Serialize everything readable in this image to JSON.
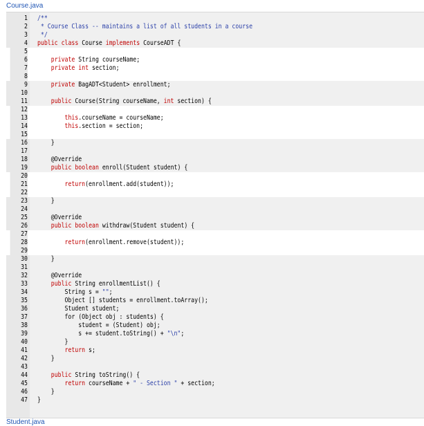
{
  "files": {
    "current": "Course.java",
    "next": "Student.java"
  },
  "colors": {
    "keyword": "#c00000",
    "comment": "#2a3fa8",
    "link": "#1f55b4"
  },
  "lines": [
    {
      "n": "1",
      "t": "/**",
      "h": false
    },
    {
      "n": "2",
      "t": " * Course Class -- maintains a list of all students in a course",
      "h": false
    },
    {
      "n": "3",
      "t": " */",
      "h": false
    },
    {
      "n": "4",
      "t": "public class Course implements CourseADT {",
      "h": false
    },
    {
      "n": "5",
      "t": "",
      "h": true
    },
    {
      "n": "6",
      "t": "    private String courseName;",
      "h": true
    },
    {
      "n": "7",
      "t": "    private int section;",
      "h": true
    },
    {
      "n": "8",
      "t": "",
      "h": true
    },
    {
      "n": "9",
      "t": "    private BagADT<Student> enrollment;",
      "h": false
    },
    {
      "n": "10",
      "t": "",
      "h": false
    },
    {
      "n": "11",
      "t": "    public Course(String courseName, int section) {",
      "h": false
    },
    {
      "n": "12",
      "t": "",
      "h": true
    },
    {
      "n": "13",
      "t": "        this.courseName = courseName;",
      "h": true
    },
    {
      "n": "14",
      "t": "        this.section = section;",
      "h": true
    },
    {
      "n": "15",
      "t": "",
      "h": true
    },
    {
      "n": "16",
      "t": "    }",
      "h": false
    },
    {
      "n": "17",
      "t": "",
      "h": false
    },
    {
      "n": "18",
      "t": "    @Override",
      "h": false
    },
    {
      "n": "19",
      "t": "    public boolean enroll(Student student) {",
      "h": false
    },
    {
      "n": "20",
      "t": "",
      "h": true
    },
    {
      "n": "21",
      "t": "        return(enrollment.add(student));",
      "h": true
    },
    {
      "n": "22",
      "t": "",
      "h": true
    },
    {
      "n": "23",
      "t": "    }",
      "h": false
    },
    {
      "n": "24",
      "t": "",
      "h": false
    },
    {
      "n": "25",
      "t": "    @Override",
      "h": false
    },
    {
      "n": "26",
      "t": "    public boolean withdraw(Student student) {",
      "h": false
    },
    {
      "n": "27",
      "t": "",
      "h": true
    },
    {
      "n": "28",
      "t": "        return(enrollment.remove(student));",
      "h": true
    },
    {
      "n": "29",
      "t": "",
      "h": true
    },
    {
      "n": "30",
      "t": "    }",
      "h": false
    },
    {
      "n": "31",
      "t": "",
      "h": false
    },
    {
      "n": "32",
      "t": "    @Override",
      "h": false
    },
    {
      "n": "33",
      "t": "    public String enrollmentList() {",
      "h": false
    },
    {
      "n": "34",
      "t": "        String s = \"\";",
      "h": false
    },
    {
      "n": "35",
      "t": "        Object [] students = enrollment.toArray();",
      "h": false
    },
    {
      "n": "36",
      "t": "        Student student;",
      "h": false
    },
    {
      "n": "37",
      "t": "        for (Object obj : students) {",
      "h": false
    },
    {
      "n": "38",
      "t": "            student = (Student) obj;",
      "h": false
    },
    {
      "n": "39",
      "t": "            s += student.toString() + \"\\n\";",
      "h": false
    },
    {
      "n": "40",
      "t": "        }",
      "h": false
    },
    {
      "n": "41",
      "t": "        return s;",
      "h": false
    },
    {
      "n": "42",
      "t": "    }",
      "h": false
    },
    {
      "n": "43",
      "t": "",
      "h": false
    },
    {
      "n": "44",
      "t": "    public String toString() {",
      "h": false
    },
    {
      "n": "45",
      "t": "        return courseName + \" - Section \" + section;",
      "h": false
    },
    {
      "n": "46",
      "t": "    }",
      "h": false
    },
    {
      "n": "47",
      "t": "}",
      "h": false
    }
  ]
}
